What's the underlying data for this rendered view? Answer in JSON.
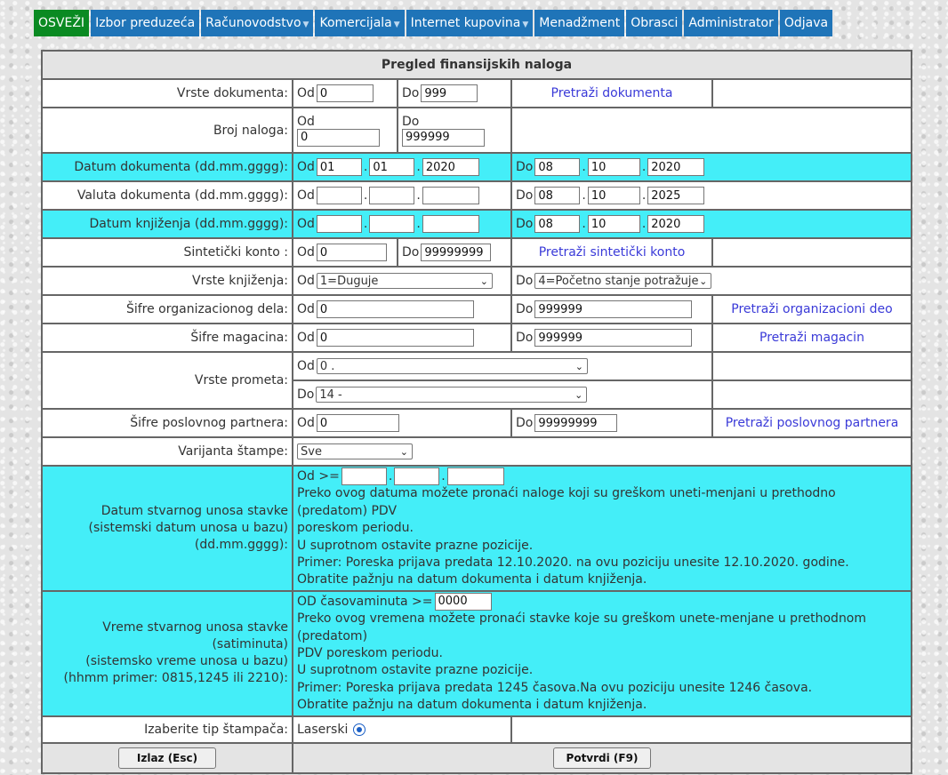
{
  "nav": {
    "items": [
      {
        "label": "OSVEŽI",
        "active": true,
        "dropdown": false
      },
      {
        "label": "Izbor preduzeća",
        "active": false,
        "dropdown": false
      },
      {
        "label": "Računovodstvo",
        "active": false,
        "dropdown": true
      },
      {
        "label": "Komercijala",
        "active": false,
        "dropdown": true
      },
      {
        "label": "Internet kupovina",
        "active": false,
        "dropdown": true
      },
      {
        "label": "Menadžment",
        "active": false,
        "dropdown": false
      },
      {
        "label": "Obrasci",
        "active": false,
        "dropdown": false
      },
      {
        "label": "Administrator",
        "active": false,
        "dropdown": false
      },
      {
        "label": "Odjava",
        "active": false,
        "dropdown": false
      }
    ],
    "active_color": "#0a8a22",
    "item_color": "#1f74b8"
  },
  "form": {
    "title": "Pregled finansijskih naloga",
    "od": "Od",
    "do": "Do",
    "vrste_dokumenta": {
      "label": "Vrste dokumenta:",
      "od": "0",
      "do": "999",
      "link": "Pretraži dokumenta"
    },
    "broj_naloga": {
      "label": "Broj naloga:",
      "od": "0",
      "do": "999999"
    },
    "datum_dokumenta": {
      "label": "Datum dokumenta (dd.mm.gggg):",
      "od_d": "01",
      "od_m": "01",
      "od_y": "2020",
      "do_d": "08",
      "do_m": "10",
      "do_y": "2020"
    },
    "valuta_dokumenta": {
      "label": "Valuta dokumenta (dd.mm.gggg):",
      "od_d": "",
      "od_m": "",
      "od_y": "",
      "do_d": "08",
      "do_m": "10",
      "do_y": "2025"
    },
    "datum_knjizenja": {
      "label": "Datum knjiženja (dd.mm.gggg):",
      "od_d": "",
      "od_m": "",
      "od_y": "",
      "do_d": "08",
      "do_m": "10",
      "do_y": "2020"
    },
    "sinteticki_konto": {
      "label": "Sintetički konto :",
      "od": "0",
      "do": "99999999",
      "link": "Pretraži sintetički konto"
    },
    "vrste_knjizenja": {
      "label": "Vrste knjiženja:",
      "od": "1=Duguje",
      "do": "4=Početno stanje potražuje"
    },
    "sifre_org": {
      "label": "Šifre organizacionog dela:",
      "od": "0",
      "do": "999999",
      "link": "Pretraži organizacioni deo"
    },
    "sifre_magacina": {
      "label": "Šifre magacina:",
      "od": "0",
      "do": "999999",
      "link": "Pretraži magacin"
    },
    "vrste_prometa": {
      "label": "Vrste prometa:",
      "od": "0 .",
      "do": "14 -"
    },
    "sifre_partnera": {
      "label": "Šifre poslovnog partnera:",
      "od": "0",
      "do": "99999999",
      "link": "Pretraži poslovnog partnera"
    },
    "varijanta_stampe": {
      "label": "Varijanta štampe:",
      "value": "Sve"
    },
    "datum_unosa": {
      "label_1": "Datum stvarnog unosa stavke",
      "label_2": "(sistemski datum unosa u bazu)",
      "label_3": "(dd.mm.gggg):",
      "prefix": "Od >=",
      "d": "",
      "m": "",
      "y": "",
      "line_1": "Preko ovog datuma možete pronaći naloge koji su greškom uneti-menjani u prethodno (predatom) PDV",
      "line_2": "poreskom periodu.",
      "line_3": "U suprotnom ostavite prazne pozicije.",
      "line_4": "Primer: Poreska prijava predata 12.10.2020. na ovu poziciju unesite 12.10.2020. godine.",
      "line_5": "Obratite pažnju na datum dokumenta i datum knjiženja."
    },
    "vreme_unosa": {
      "label_1": "Vreme stvarnog unosa stavke",
      "label_2": "(satiminuta)",
      "label_3": "(sistemsko vreme unosa u bazu)",
      "label_4": "(hhmm primer: 0815,1245 ili 2210):",
      "prefix": "OD časovaminuta >=",
      "value": "0000",
      "line_1": "Preko ovog vremena možete pronaći stavke koje su greškom unete-menjane u prethodnom (predatom)",
      "line_2": "PDV poreskom periodu.",
      "line_3": "U suprotnom ostavite prazne pozicije.",
      "line_4": "Primer: Poreska prijava predata 1245 časova.Na ovu poziciju unesite 1246 časova.",
      "line_5": "Obratite pažnju na datum dokumenta i datum knjiženja."
    },
    "stampac": {
      "label": "Izaberite tip štampača:",
      "option": "Laserski"
    },
    "buttons": {
      "izlaz": "Izlaz (Esc)",
      "potvrdi": "Potvrdi (F9)"
    },
    "highlight_color": "#44eef8"
  }
}
